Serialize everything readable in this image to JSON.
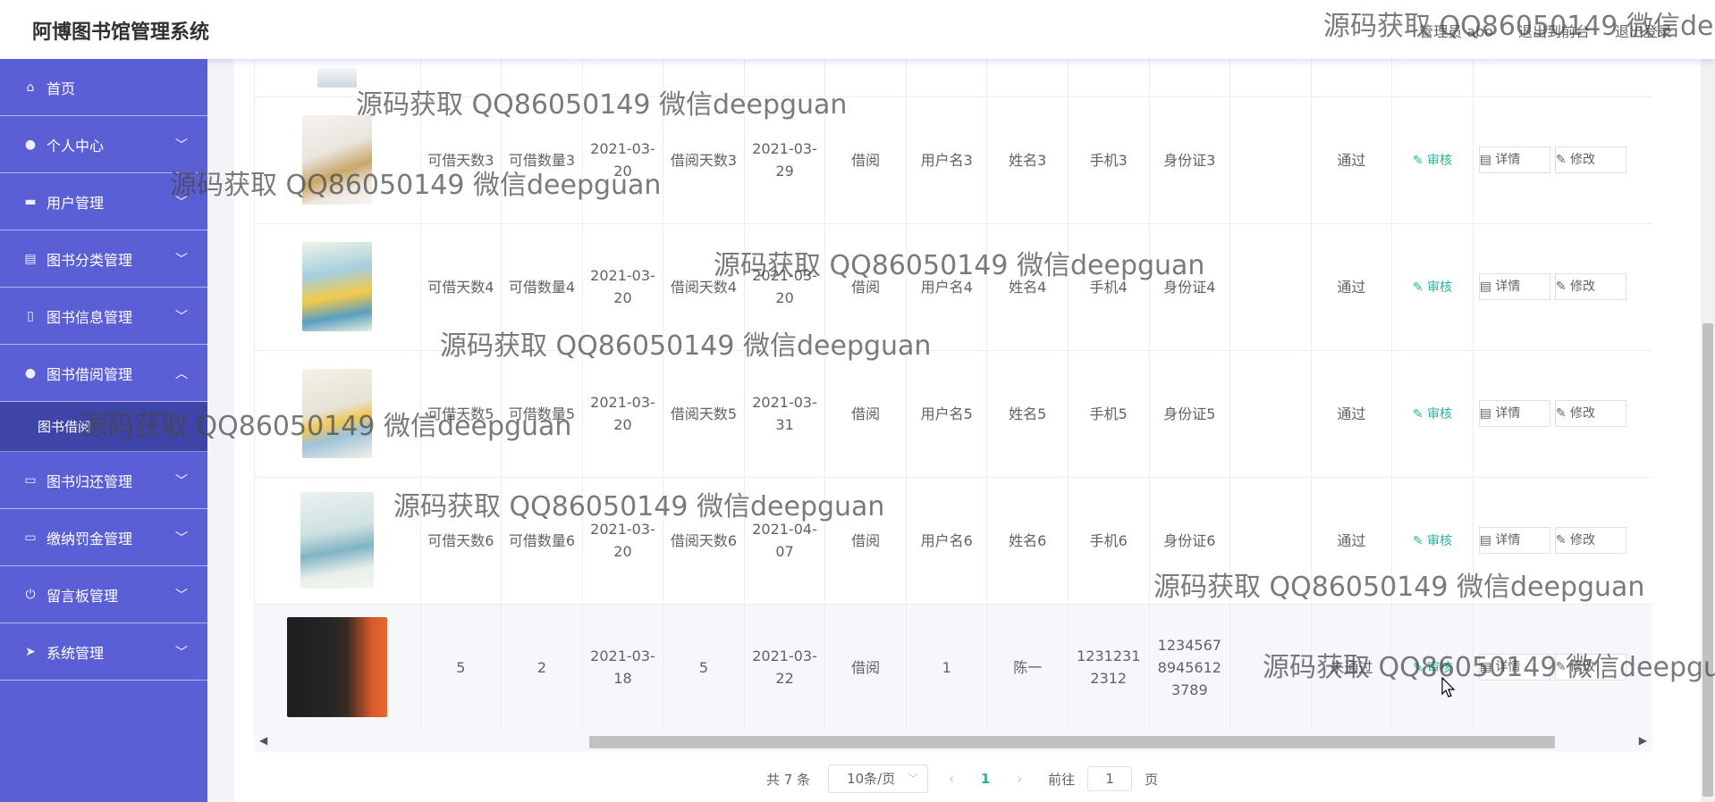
{
  "header": {
    "title": "阿博图书馆管理系统",
    "admin": "管理员 abo",
    "to_front": "退出到前台",
    "logout": "退出登录"
  },
  "sidebar": {
    "items": [
      {
        "label": "首页",
        "icon": "home-icon"
      },
      {
        "label": "个人中心",
        "icon": "user-icon"
      },
      {
        "label": "用户管理",
        "icon": "briefcase-icon"
      },
      {
        "label": "图书分类管理",
        "icon": "clipboard-icon"
      },
      {
        "label": "图书信息管理",
        "icon": "book-icon"
      },
      {
        "label": "图书借阅管理",
        "icon": "person-icon"
      },
      {
        "label": "图书归还管理",
        "icon": "monitor-icon"
      },
      {
        "label": "缴纳罚金管理",
        "icon": "monitor-icon"
      },
      {
        "label": "留言板管理",
        "icon": "power-icon"
      },
      {
        "label": "系统管理",
        "icon": "send-icon"
      }
    ],
    "active_sub": "图书借阅"
  },
  "table": {
    "rows": [
      {
        "c1": "可借天数3",
        "c2": "可借数量3",
        "c3": "2021-03-20",
        "c4": "借阅天数3",
        "c5": "2021-03-29",
        "c6": "借阅",
        "c7": "用户名3",
        "c8": "姓名3",
        "c9": "手机3",
        "c10": "身份证3",
        "c11": "",
        "c12": "通过",
        "audit": "审核",
        "detail": "详情",
        "edit": "修改"
      },
      {
        "c1": "可借天数4",
        "c2": "可借数量4",
        "c3": "2021-03-20",
        "c4": "借阅天数4",
        "c5": "2021-03-20",
        "c6": "借阅",
        "c7": "用户名4",
        "c8": "姓名4",
        "c9": "手机4",
        "c10": "身份证4",
        "c11": "",
        "c12": "通过",
        "audit": "审核",
        "detail": "详情",
        "edit": "修改"
      },
      {
        "c1": "可借天数5",
        "c2": "可借数量5",
        "c3": "2021-03-20",
        "c4": "借阅天数5",
        "c5": "2021-03-31",
        "c6": "借阅",
        "c7": "用户名5",
        "c8": "姓名5",
        "c9": "手机5",
        "c10": "身份证5",
        "c11": "",
        "c12": "通过",
        "audit": "审核",
        "detail": "详情",
        "edit": "修改"
      },
      {
        "c1": "可借天数6",
        "c2": "可借数量6",
        "c3": "2021-03-20",
        "c4": "借阅天数6",
        "c5": "2021-04-07",
        "c6": "借阅",
        "c7": "用户名6",
        "c8": "姓名6",
        "c9": "手机6",
        "c10": "身份证6",
        "c11": "",
        "c12": "通过",
        "audit": "审核",
        "detail": "详情",
        "edit": "修改"
      },
      {
        "c1": "5",
        "c2": "2",
        "c3": "2021-03-18",
        "c4": "5",
        "c5": "2021-03-22",
        "c6": "借阅",
        "c7": "1",
        "c8": "陈一",
        "c9": "12312312312",
        "c10": "123456789456123789",
        "c11": "",
        "c12": "未通过",
        "audit": "审核",
        "detail": "详情",
        "edit": "修改"
      }
    ]
  },
  "pager": {
    "total": "共 7 条",
    "size": "10条/页",
    "current": "1",
    "goto_prefix": "前往",
    "goto_value": "1",
    "goto_suffix": "页"
  },
  "watermark": "源码获取 QQ86050149 微信deepguan",
  "colors": {
    "sidebar": "#5a5fd6",
    "accent": "#27b59a"
  }
}
